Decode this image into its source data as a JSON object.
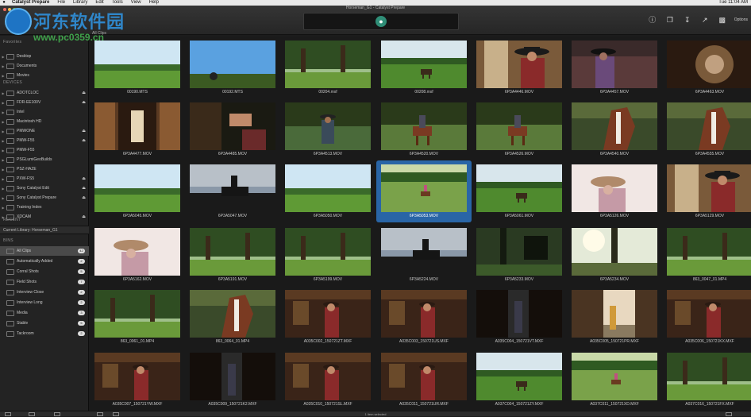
{
  "menubar": {
    "apple": "",
    "items": [
      "Catalyst Prepare",
      "File",
      "Library",
      "Edit",
      "Tools",
      "View",
      "Help"
    ],
    "clock": "Tue 11:04 AM"
  },
  "window": {
    "title": "Horseman_G1 - Catalyst Prepare",
    "tab": "All Clips",
    "options_label": "Options"
  },
  "watermark": {
    "text": "河东软件园",
    "url": "www.pc0359.cn"
  },
  "sidebar": {
    "top_label": "Favorites",
    "favorites": [
      "Desktop",
      "Documents",
      "Movies"
    ],
    "devices_title": "DEVICES",
    "devices": [
      {
        "label": "ADOTCLOC",
        "eject": true
      },
      {
        "label": "FDR-EE100V",
        "eject": true
      },
      {
        "label": "Intel",
        "eject": false
      },
      {
        "label": "Macintosh HD",
        "eject": false
      },
      {
        "label": "PMWONE",
        "eject": true
      },
      {
        "label": "PMW-F55",
        "eject": true
      },
      {
        "label": "PMW-F55",
        "eject": false
      },
      {
        "label": "PSGLumiGeoBuilds",
        "eject": false
      },
      {
        "label": "PSZ-HAZE",
        "eject": false
      },
      {
        "label": "PXW-FS5",
        "eject": true
      },
      {
        "label": "Sony Catalyst Edit",
        "eject": true
      },
      {
        "label": "Sony Catalyst Prepare",
        "eject": true
      },
      {
        "label": "Training Index",
        "eject": false
      },
      {
        "label": "XDCAM",
        "eject": true
      }
    ],
    "recent_title": "RECENT",
    "library": "Current Library: Horseman_G1",
    "bins_title": "BINS",
    "bins": [
      {
        "label": "All Clips",
        "count": "42",
        "selected": true
      },
      {
        "label": "Automatically Added",
        "count": "2",
        "selected": false
      },
      {
        "label": "Corral Shots",
        "count": "5",
        "selected": false
      },
      {
        "label": "Field Shots",
        "count": "7",
        "selected": false
      },
      {
        "label": "Interview Close",
        "count": "2",
        "selected": false
      },
      {
        "label": "Interview Long",
        "count": "2",
        "selected": false
      },
      {
        "label": "Media",
        "count": "3",
        "selected": false
      },
      {
        "label": "Stable",
        "count": "5",
        "selected": false
      },
      {
        "label": "Tackroom",
        "count": "2",
        "selected": false
      }
    ]
  },
  "clips": [
    {
      "name": "00190.MTS",
      "scene": "field"
    },
    {
      "name": "00192.MTS",
      "scene": "sky"
    },
    {
      "name": "00204.mxf",
      "scene": "trees"
    },
    {
      "name": "00208.mxf",
      "scene": "field-horse"
    },
    {
      "name": "6P3A4446.MOV",
      "scene": "cowboy"
    },
    {
      "name": "6P3A4457.MOV",
      "scene": "cowboy-dark"
    },
    {
      "name": "6P3A4463.MOV",
      "scene": "closeup"
    },
    {
      "name": "6P3A4477.MOV",
      "scene": "stable"
    },
    {
      "name": "6P3A4485.MOV",
      "scene": "hands"
    },
    {
      "name": "6P3A4513.MOV",
      "scene": "cowboy-trees"
    },
    {
      "name": "6P3A4520.MOV",
      "scene": "rider-trees"
    },
    {
      "name": "6P3A4526.MOV",
      "scene": "rider-trees"
    },
    {
      "name": "6P3A4540.MOV",
      "scene": "horse-head"
    },
    {
      "name": "6P3A4555.MOV",
      "scene": "horse-head"
    },
    {
      "name": "6P3A5045.MOV",
      "scene": "field"
    },
    {
      "name": "6P3A5047.MOV",
      "scene": "silhouette"
    },
    {
      "name": "6P3A5050.MOV",
      "scene": "field"
    },
    {
      "name": "6P3A5053.MOV",
      "scene": "field-rider"
    },
    {
      "name": "6P3A5061.MOV",
      "scene": "field-horse"
    },
    {
      "name": "6P3A5126.MOV",
      "scene": "cowboy-bright"
    },
    {
      "name": "6P3A5129.MOV",
      "scene": "cowboy"
    },
    {
      "name": "6P3A5162.MOV",
      "scene": "cowboy-bright"
    },
    {
      "name": "6P3A5191.MOV",
      "scene": "trees"
    },
    {
      "name": "6P3A5199.MOV",
      "scene": "trees"
    },
    {
      "name": "6P3A5224.MOV",
      "scene": "silhouette"
    },
    {
      "name": "6P3A5233.MOV",
      "scene": "trees-dark"
    },
    {
      "name": "6P3A5234.MOV",
      "scene": "sunlit"
    },
    {
      "name": "863_0047_01.MP4",
      "scene": "trees"
    },
    {
      "name": "863_0061_01.MP4",
      "scene": "trees"
    },
    {
      "name": "863_0064_01.MP4",
      "scene": "horse-head"
    },
    {
      "name": "A035C002_150721ZT.MXF",
      "scene": "interior"
    },
    {
      "name": "A035C003_150721US.MXF",
      "scene": "interior"
    },
    {
      "name": "A035C004_150721VT.MXF",
      "scene": "dark"
    },
    {
      "name": "A035C005_150721PR.MXF",
      "scene": "interior-light"
    },
    {
      "name": "A035C006_150721KX.MXF",
      "scene": "interior"
    },
    {
      "name": "A035C007_150721YW.MXF",
      "scene": "interior"
    },
    {
      "name": "A035C009_150721K2.MXF",
      "scene": "dark"
    },
    {
      "name": "A035C010_150721SL.MXF",
      "scene": "interior"
    },
    {
      "name": "A035C011_150721UR.MXF",
      "scene": "interior"
    },
    {
      "name": "A037C004_150721ZY.MXF",
      "scene": "field-horse"
    },
    {
      "name": "A037C011_150721XD.MXF",
      "scene": "field-rider"
    },
    {
      "name": "A037C016_150721FX.MXF",
      "scene": "trees"
    }
  ],
  "selected_clip": "6P3A5053.MOV",
  "status": "1 item selected",
  "colors": {
    "selection": "#2965a6",
    "background": "#1a1a1a",
    "sidebar": "#232323",
    "accent": "#2f8e77"
  }
}
